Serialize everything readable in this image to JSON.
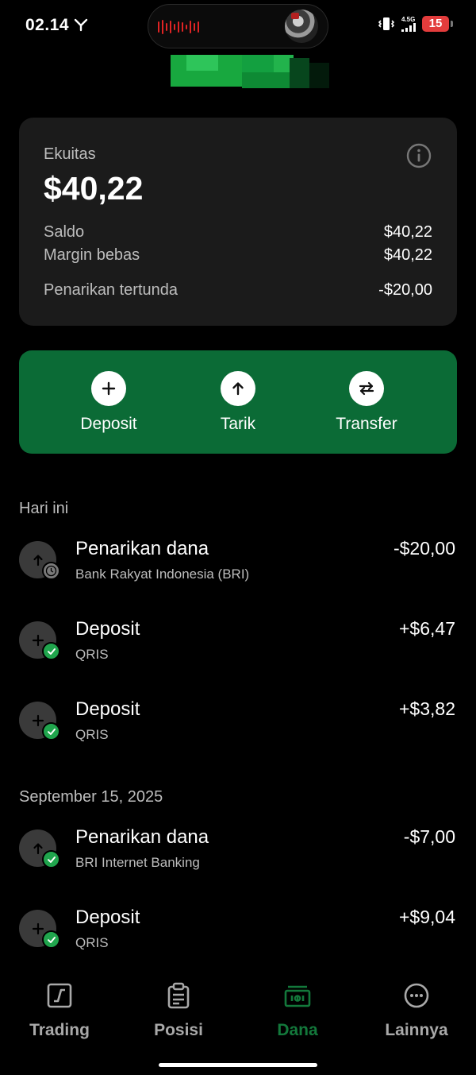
{
  "status_bar": {
    "time": "02.14",
    "network_label": "4.5G",
    "battery": "15"
  },
  "equity": {
    "label": "Ekuitas",
    "value": "$40,22",
    "rows": [
      {
        "label": "Saldo",
        "value": "$40,22"
      },
      {
        "label": "Margin bebas",
        "value": "$40,22"
      },
      {
        "label": "Penarikan tertunda",
        "value": "-$20,00"
      }
    ]
  },
  "actions": [
    {
      "label": "Deposit",
      "icon": "plus-icon"
    },
    {
      "label": "Tarik",
      "icon": "arrow-up-icon"
    },
    {
      "label": "Transfer",
      "icon": "swap-icon"
    }
  ],
  "sections": [
    {
      "heading": "Hari ini",
      "transactions": [
        {
          "title": "Penarikan dana",
          "subtitle": "Bank Rakyat Indonesia (BRI)",
          "amount": "-$20,00",
          "type": "withdraw",
          "status": "pending"
        },
        {
          "title": "Deposit",
          "subtitle": "QRIS",
          "amount": "+$6,47",
          "type": "deposit",
          "status": "completed"
        },
        {
          "title": "Deposit",
          "subtitle": "QRIS",
          "amount": "+$3,82",
          "type": "deposit",
          "status": "completed"
        }
      ]
    },
    {
      "heading": "September 15, 2025",
      "transactions": [
        {
          "title": "Penarikan dana",
          "subtitle": "BRI Internet Banking",
          "amount": "-$7,00",
          "type": "withdraw",
          "status": "completed"
        },
        {
          "title": "Deposit",
          "subtitle": "QRIS",
          "amount": "+$9,04",
          "type": "deposit",
          "status": "completed"
        }
      ]
    }
  ],
  "nav": [
    {
      "label": "Trading",
      "icon": "chart-icon",
      "active": false
    },
    {
      "label": "Posisi",
      "icon": "clipboard-icon",
      "active": false
    },
    {
      "label": "Dana",
      "icon": "wallet-icon",
      "active": true
    },
    {
      "label": "Lainnya",
      "icon": "more-icon",
      "active": false
    }
  ],
  "colors": {
    "accent_green": "#0b6b36",
    "active_nav": "#13783b",
    "success": "#20a54d",
    "card_bg": "#1b1b1b"
  }
}
